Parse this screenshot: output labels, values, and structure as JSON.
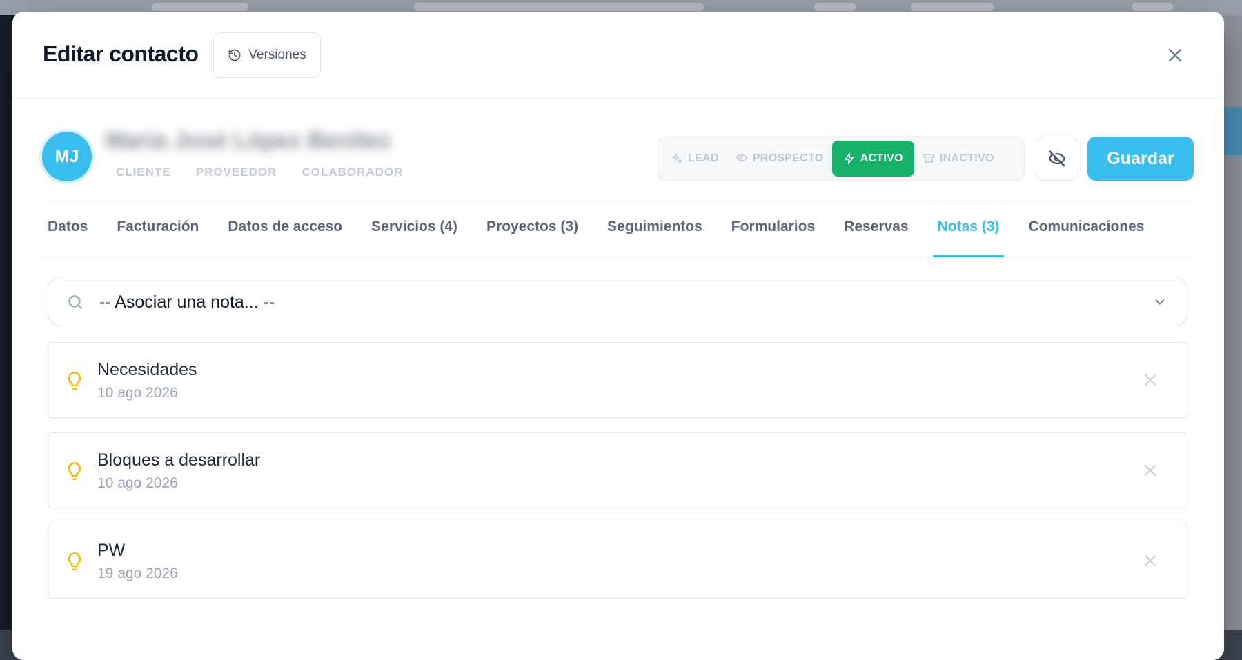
{
  "modal": {
    "title": "Editar contacto",
    "versions_label": "Versiones"
  },
  "contact": {
    "initials": "MJ",
    "name": "Maria José López Benítez",
    "roles": [
      {
        "label": "CLIENTE",
        "active": true
      },
      {
        "label": "PROVEEDOR",
        "active": false
      },
      {
        "label": "COLABORADOR",
        "active": false
      }
    ]
  },
  "statuses": [
    {
      "label": "LEAD",
      "icon": "sparkles-icon"
    },
    {
      "label": "PROSPECTO",
      "icon": "handshake-icon"
    },
    {
      "label": "ACTIVO",
      "icon": "lightning-icon",
      "active": true
    },
    {
      "label": "INACTIVO",
      "icon": "archive-icon"
    }
  ],
  "toolbar": {
    "visibility_icon": "eye-off-icon",
    "save_label": "Guardar"
  },
  "tabs": [
    {
      "label": "Datos"
    },
    {
      "label": "Facturación"
    },
    {
      "label": "Datos de acceso"
    },
    {
      "label": "Servicios (4)"
    },
    {
      "label": "Proyectos (3)"
    },
    {
      "label": "Seguimientos"
    },
    {
      "label": "Formularios"
    },
    {
      "label": "Reservas"
    },
    {
      "label": "Notas (3)",
      "active": true
    },
    {
      "label": "Comunicaciones"
    }
  ],
  "notes_panel": {
    "search_placeholder": "-- Asociar una nota... --",
    "notes": [
      {
        "title": "Necesidades",
        "date": "10 ago 2026"
      },
      {
        "title": "Bloques a desarrollar",
        "date": "10 ago 2026"
      },
      {
        "title": "PW",
        "date": "19 ago 2026"
      }
    ]
  },
  "colors": {
    "accent": "#38bdee",
    "active_status": "#17b26a",
    "note_icon": "#f5b800"
  }
}
